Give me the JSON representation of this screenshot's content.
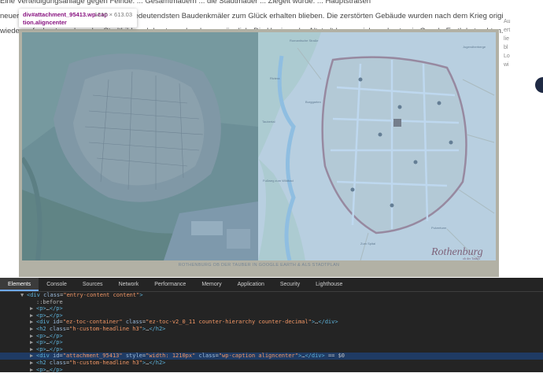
{
  "article": {
    "lines": [
      "Eine Verteidigungsanlage gegen Feinde. ... Gesamtmauern ... die Stadtmauer ... Ziegelt wurde. ... Hauptstraßen",
      "neuere Ostteil der Altstadt, so dass die bedeutendsten Baudenkmäler zum Glück erhalten blieben. Die zerstörten Gebäude wurden nach dem Krieg originalgetreu und sehr schlicht",
      "wieder aufgebaut, so dass das Stadtbild auch heute noch sehr ursprünglich. Die Umrisse der Altstadt lassen sich am besten in Google Earth betrachten."
    ]
  },
  "tooltip": {
    "selector_line1": "div#attachment_95413.wp-cap",
    "selector_line2": "tion.aligncenter",
    "dimensions": "1210 × 613.03"
  },
  "figure": {
    "caption": "ROTHENBURG OB DER TAUBER IN GOOGLE EARTH & ALS STADTPLAN",
    "logo_text": "Rothenburg",
    "logo_sub": "ob der Tauber",
    "map_labels": [
      "Romantische Straße",
      "Jugendherberge",
      "Zum Spital",
      "Taubertal",
      "Fußweg zum Wildbad",
      "Riviera",
      "Pulverturm",
      "Burggarten"
    ]
  },
  "sidebar": {
    "lines": [
      "Au",
      "ert",
      "lie",
      "bl",
      "Lo",
      "wi"
    ]
  },
  "devtools": {
    "tabs": [
      "Elements",
      "Console",
      "Sources",
      "Network",
      "Performance",
      "Memory",
      "Application",
      "Security",
      "Lighthouse"
    ],
    "active_tab": "Elements",
    "rows": [
      {
        "indent": 1,
        "arrow": "▼",
        "html": "<span class='tag'>&lt;div</span> <span class='attr'>class</span>=<span class='val'>\"entry-content content\"</span><span class='tag'>&gt;</span>"
      },
      {
        "indent": 2,
        "arrow": "",
        "html": "<span class='pseudo'>::before</span>"
      },
      {
        "indent": 2,
        "arrow": "▶",
        "html": "<span class='tag'>&lt;p&gt;</span>…<span class='tag'>&lt;/p&gt;</span>"
      },
      {
        "indent": 2,
        "arrow": "▶",
        "html": "<span class='tag'>&lt;p&gt;</span>…<span class='tag'>&lt;/p&gt;</span>"
      },
      {
        "indent": 2,
        "arrow": "▶",
        "html": "<span class='tag'>&lt;div</span> <span class='attr'>id</span>=<span class='val'>\"ez-toc-container\"</span> <span class='attr'>class</span>=<span class='val'>\"ez-toc-v2_0_11 counter-hierarchy counter-decimal\"</span><span class='tag'>&gt;</span>…<span class='tag'>&lt;/div&gt;</span>"
      },
      {
        "indent": 2,
        "arrow": "▶",
        "html": "<span class='tag'>&lt;h2</span> <span class='attr'>class</span>=<span class='val'>\"h-custom-headline h3\"</span><span class='tag'>&gt;</span>…<span class='tag'>&lt;/h2&gt;</span>"
      },
      {
        "indent": 2,
        "arrow": "▶",
        "html": "<span class='tag'>&lt;p&gt;</span>…<span class='tag'>&lt;/p&gt;</span>"
      },
      {
        "indent": 2,
        "arrow": "▶",
        "html": "<span class='tag'>&lt;p&gt;</span>…<span class='tag'>&lt;/p&gt;</span>"
      },
      {
        "indent": 2,
        "arrow": "▶",
        "html": "<span class='tag'>&lt;p&gt;</span>…<span class='tag'>&lt;/p&gt;</span>"
      },
      {
        "indent": 2,
        "arrow": "▶",
        "html": "<span class='tag'>&lt;div</span> <span class='attr'>id</span>=<span class='val'>\"attachment_95413\"</span> <span class='attr'>style</span>=<span class='val'>\"width: 1210px\"</span> <span class='attr'>class</span>=<span class='val'>\"wp-caption aligncenter\"</span><span class='tag'>&gt;</span>…<span class='tag'>&lt;/div&gt;</span> == $0",
        "selected": true
      },
      {
        "indent": 2,
        "arrow": "▶",
        "html": "<span class='tag'>&lt;h2</span> <span class='attr'>class</span>=<span class='val'>\"h-custom-headline h3\"</span><span class='tag'>&gt;</span>…<span class='tag'>&lt;/h2&gt;</span>"
      },
      {
        "indent": 2,
        "arrow": "▶",
        "html": "<span class='tag'>&lt;p&gt;</span>…<span class='tag'>&lt;/p&gt;</span>"
      }
    ]
  }
}
